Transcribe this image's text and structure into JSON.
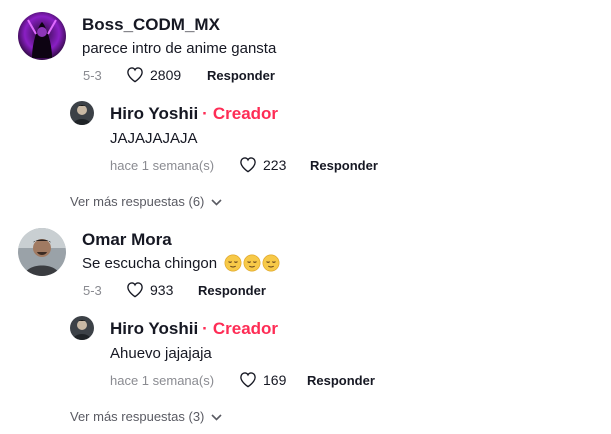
{
  "comments": [
    {
      "username": "Boss_CODM_MX",
      "text": "parece intro de anime gansta",
      "date": "5-3",
      "likes": "2809",
      "reply_label": "Responder",
      "avatar_icon": "purple-neon-avatar",
      "reply": {
        "username": "Hiro Yoshii",
        "separator": "·",
        "badge": "Creador",
        "text": "JAJAJAJAJA",
        "date": "hace 1 semana(s)",
        "likes": "223",
        "reply_label": "Responder",
        "avatar_icon": "hiro-avatar"
      },
      "more_replies": "Ver más respuestas (6)"
    },
    {
      "username": "Omar Mora",
      "text": "Se escucha chingon",
      "emojis": [
        "relieved-face-emoji",
        "relieved-face-emoji",
        "relieved-face-emoji"
      ],
      "date": "5-3",
      "likes": "933",
      "reply_label": "Responder",
      "avatar_icon": "omar-avatar",
      "reply": {
        "username": "Hiro Yoshii",
        "separator": "·",
        "badge": "Creador",
        "text": "Ahuevo jajajaja",
        "date": "hace 1 semana(s)",
        "likes": "169",
        "reply_label": "Responder",
        "avatar_icon": "hiro-avatar"
      },
      "more_replies": "Ver más respuestas (3)"
    }
  ],
  "colors": {
    "creator_accent": "#fe2c55",
    "meta_gray": "#8a8b91",
    "text_dark": "#161823"
  }
}
